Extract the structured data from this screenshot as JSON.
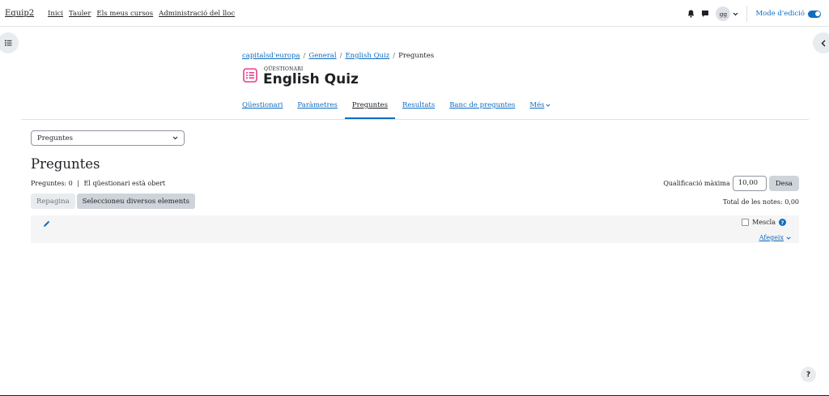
{
  "topbar": {
    "brand": "Equip2",
    "nav": [
      "Inici",
      "Tauler",
      "Els meus cursos",
      "Administració del lloc"
    ],
    "avatar_initials": "gg",
    "edit_mode_label": "Mode d'edició",
    "icons": [
      "bell-icon",
      "chat-icon",
      "chevron-down-icon"
    ]
  },
  "breadcrumb": {
    "items": [
      "capitalsd'europa",
      "General",
      "English Quiz",
      "Preguntes"
    ],
    "separator": "/"
  },
  "header": {
    "module_type": "QÜESTIONARI",
    "title": "English Quiz",
    "module_icon_color": "#e83e8c"
  },
  "secondary_nav": {
    "tabs": [
      "Qüestionari",
      "Paràmetres",
      "Preguntes",
      "Resultats",
      "Banc de preguntes",
      "Més"
    ],
    "active_index": 2
  },
  "content": {
    "select_value": "Preguntes",
    "heading": "Preguntes",
    "questions_info": "Preguntes: 0",
    "quiz_status": "El qüestionari està obert",
    "max_grade_label": "Qualificació màxima",
    "max_grade_value": "10,00",
    "save_button": "Desa",
    "repaginate_button": "Repagina",
    "select_multiple_button": "Seleccioneu diversos elements",
    "total_marks": "Total de les notes: 0,00",
    "shuffle_label": "Mescla",
    "add_label": "Afegeix"
  },
  "help_button": "?",
  "colors": {
    "accent": "#0f6cbf",
    "text": "#1d2125",
    "button_gray": "#ced4da",
    "section_bg": "#f5f5f5"
  }
}
